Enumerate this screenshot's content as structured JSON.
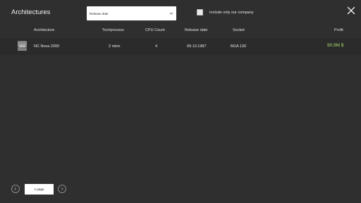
{
  "header": {
    "title": "Architectures",
    "sort": {
      "selected": "Release date"
    },
    "filter": {
      "label": "Include only our company",
      "checked": false
    },
    "close_icon": "close-icon"
  },
  "table": {
    "columns": [
      "Architecture",
      "Techprocess",
      "CPU Count",
      "Release date",
      "Socket",
      "Profit"
    ],
    "rows": [
      {
        "architecture": "NC Nova 2000",
        "techprocess": "2 mkm",
        "cpu_count": "4",
        "release_date": "09.10.1987",
        "socket": "BGA 130",
        "profit": "90.9M $"
      }
    ]
  },
  "pagination": {
    "page_label": "1 page",
    "prev_icon": "chevron-left-icon",
    "next_icon": "chevron-right-icon"
  },
  "colors": {
    "background": "#2f2f2f",
    "profit": "#a6df6b"
  }
}
